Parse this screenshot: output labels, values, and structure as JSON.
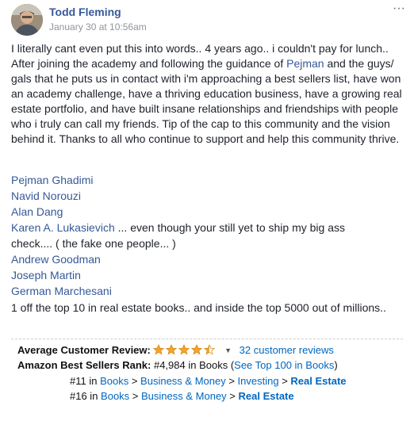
{
  "post": {
    "author": "Todd Fleming",
    "timestamp": "January 30 at 10:56am",
    "more_label": "···",
    "body": {
      "part1": "I literally cant even put this into words.. 4 years ago.. i couldn't pay for lunch.. After joining the academy and following the guidance of ",
      "mention": "Pejman",
      "part2": " and the guys/ gals that he puts us in contact with i'm approaching a best sellers list, have won an academy challenge, have a thriving education business, have a growing real estate portfolio, and have built insane relationships and friendships with people who i truly can call my friends. Tip of the cap to this community and the vision behind it. Thanks to all who continue to support and help this community thrive."
    },
    "mentions": [
      {
        "name": "Pejman Ghadimi",
        "suffix": ""
      },
      {
        "name": "Navid Norouzi",
        "suffix": ""
      },
      {
        "name": "Alan Dang",
        "suffix": ""
      },
      {
        "name": "Karen A. Lukasievich",
        "suffix": " ... even though your still yet to ship my big ass"
      },
      {
        "name": "",
        "suffix": "check.... ( the fake one people... )"
      },
      {
        "name": "Andrew Goodman",
        "suffix": ""
      },
      {
        "name": "Joseph Martin",
        "suffix": ""
      },
      {
        "name": "German Marchesani",
        "suffix": ""
      }
    ],
    "closing": "1 off the top 10 in real estate books.. and inside the top 5000 out of millions.."
  },
  "amazon": {
    "review_label": "Average Customer Review:",
    "rating_stars": 4.5,
    "reviews_count": "32 customer reviews",
    "bsr_label": "Amazon Best Sellers Rank:",
    "bsr_value": "#4,984 in Books (",
    "bsr_link": "See Top 100 in Books",
    "bsr_close": ")",
    "ranks": [
      {
        "rank": "#11 in ",
        "path": [
          "Books",
          "Business & Money",
          "Investing"
        ],
        "final": "Real Estate"
      },
      {
        "rank": "#16 in ",
        "path": [
          "Books",
          "Business & Money"
        ],
        "final": "Real Estate"
      }
    ],
    "separator": " > ",
    "colors": {
      "star": "#f4a429",
      "link": "#0066c0"
    }
  }
}
